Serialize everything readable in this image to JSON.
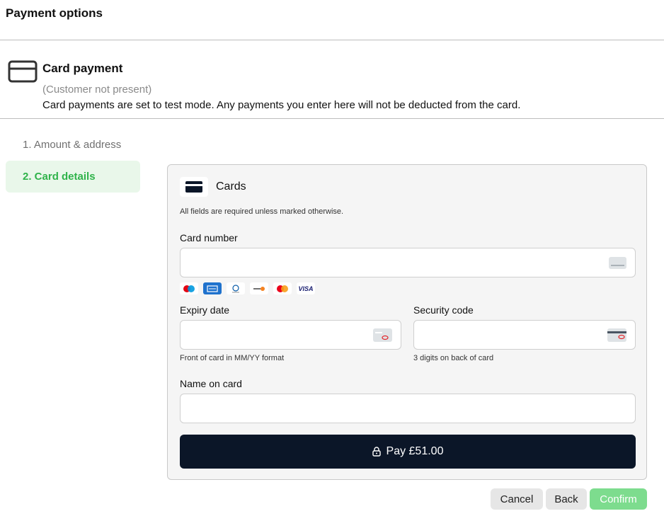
{
  "header": {
    "title": "Payment options"
  },
  "method": {
    "title": "Card payment",
    "subtitle": "(Customer not present)",
    "note": "Card payments are set to test mode. Any payments you enter here will not be deducted from the card."
  },
  "steps": [
    {
      "label": "1. Amount & address"
    },
    {
      "label": "2. Card details"
    }
  ],
  "form": {
    "title": "Cards",
    "required_note": "All fields are required unless marked otherwise.",
    "card_number": {
      "label": "Card number",
      "value": ""
    },
    "brands": [
      "maestro-icon",
      "amex-icon",
      "diners-club-icon",
      "discover-icon",
      "mastercard-icon",
      "visa-icon"
    ],
    "brand_visa_text": "VISA",
    "expiry": {
      "label": "Expiry date",
      "value": "",
      "hint": "Front of card in MM/YY format"
    },
    "security": {
      "label": "Security code",
      "value": "",
      "hint": "3 digits on back of card"
    },
    "name": {
      "label": "Name on card",
      "value": ""
    },
    "pay_label": "Pay £51.00"
  },
  "actions": {
    "cancel": "Cancel",
    "back": "Back",
    "confirm": "Confirm"
  },
  "colors": {
    "primary": "#0b1628",
    "accent_green": "#2fb34a",
    "confirm_bg": "#7ddc8e",
    "active_step_bg": "#e9f7ea"
  }
}
